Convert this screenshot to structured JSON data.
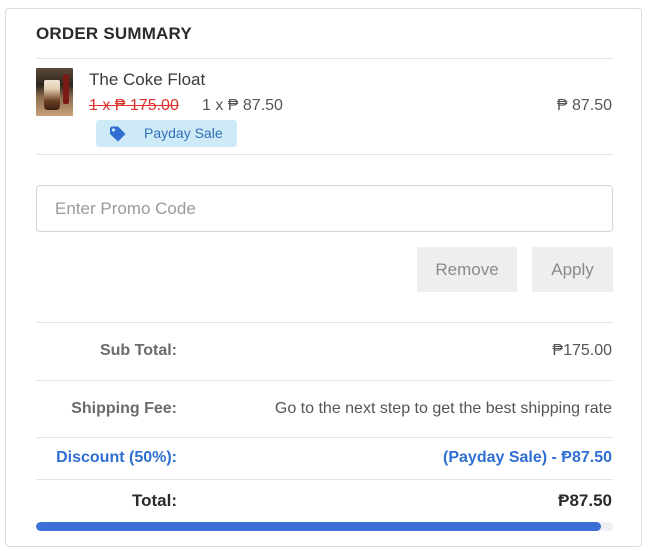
{
  "summary": {
    "title": "ORDER SUMMARY"
  },
  "item": {
    "name": "The Coke Float",
    "original_price": "1 x ₱ 175.00",
    "sale_price": "1 x ₱ 87.50",
    "line_total": "₱ 87.50",
    "badge": {
      "icon": "tag-icon",
      "label": "Payday Sale"
    }
  },
  "promo": {
    "placeholder": "Enter Promo Code",
    "value": ""
  },
  "buttons": {
    "remove": "Remove",
    "apply": "Apply"
  },
  "totals": {
    "subtotal_label": "Sub Total:",
    "subtotal_value": "₱175.00",
    "shipping_label": "Shipping Fee:",
    "shipping_value": "Go to the next step to get the best shipping rate",
    "discount_label": "Discount (50%):",
    "discount_value": "(Payday Sale) - Ᵽ87.50",
    "total_label": "Total:",
    "total_value": "Ᵽ87.50"
  },
  "progress": {
    "percent": 98
  },
  "colors": {
    "accent": "#3c6fd8",
    "strike": "#e0302b",
    "badge_bg": "#cfeaf7",
    "badge_text": "#2f6fb8",
    "button_bg": "#eeeeee"
  }
}
